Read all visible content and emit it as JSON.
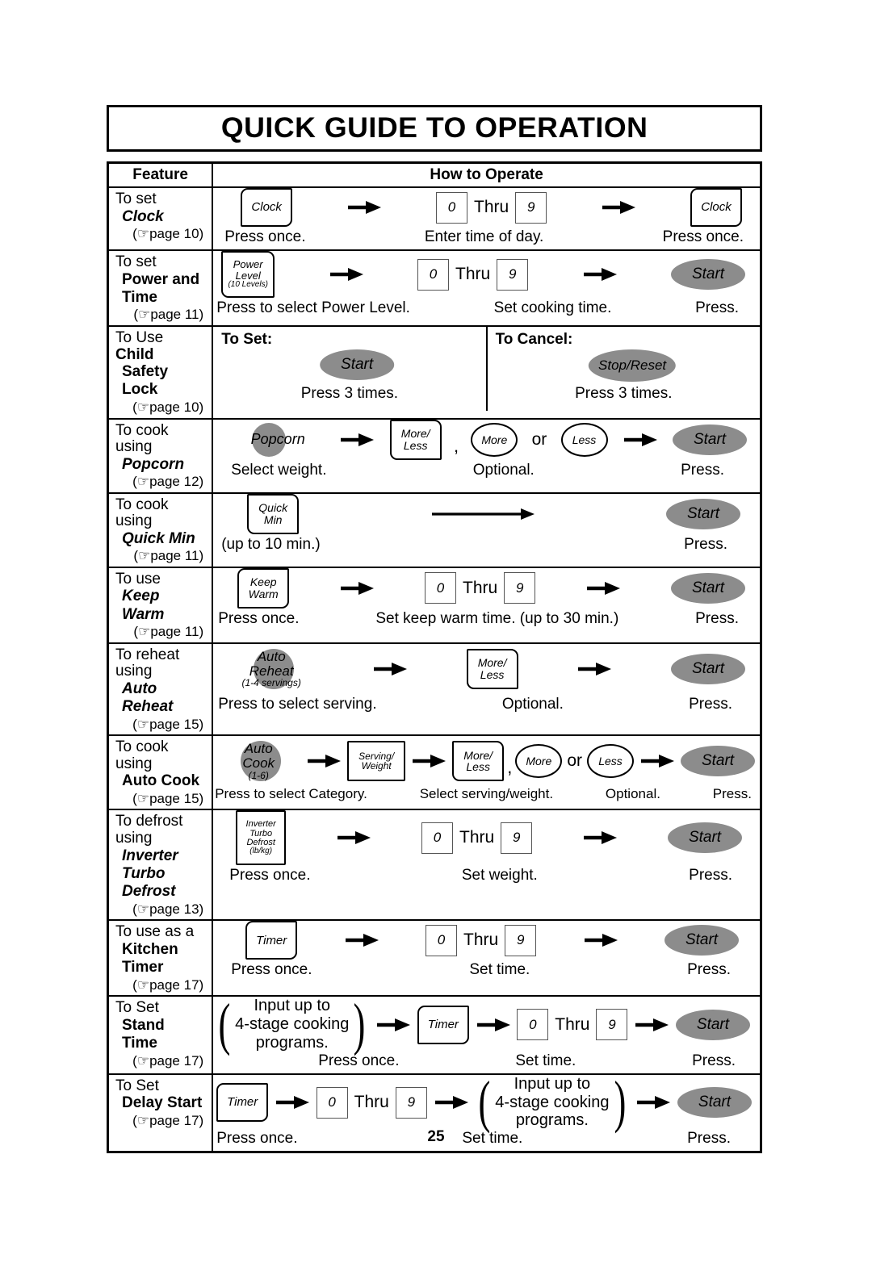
{
  "document": {
    "title": "QUICK GUIDE TO OPERATION",
    "page_number": "25"
  },
  "table": {
    "headers": {
      "feature": "Feature",
      "how_to_operate": "How to Operate"
    },
    "page_ref_icon": "pointing-hand-icon",
    "rows": [
      {
        "id": "clock",
        "feature": {
          "prefix": "To set",
          "name": "Clock",
          "style": "italic",
          "page_ref": "(☞page 10)",
          "page": "10"
        },
        "steps": [
          {
            "type": "button",
            "label": "Clock",
            "shape": "key-left"
          },
          {
            "type": "arrow"
          },
          {
            "type": "numrange",
            "from": "0",
            "thru": "Thru",
            "to": "9"
          },
          {
            "type": "arrow"
          },
          {
            "type": "button",
            "label": "Clock",
            "shape": "key-left"
          }
        ],
        "captions": [
          "Press once.",
          "Enter time of day.",
          "Press once."
        ]
      },
      {
        "id": "power-and-time",
        "feature": {
          "prefix": "To set",
          "name": "Power and Time",
          "style": "bold",
          "page_ref": "(☞page 11)",
          "page": "11"
        },
        "steps": [
          {
            "type": "button",
            "label": "Power\nLevel",
            "sublabel": "(10 Levels)",
            "shape": "key-right"
          },
          {
            "type": "arrow"
          },
          {
            "type": "numrange",
            "from": "0",
            "thru": "Thru",
            "to": "9"
          },
          {
            "type": "arrow"
          },
          {
            "type": "oval",
            "label": "Start"
          }
        ],
        "captions": [
          "Press to select Power Level.",
          "Set cooking time.",
          "Press."
        ]
      },
      {
        "id": "child-safety-lock",
        "feature": {
          "prefix": "To Use",
          "prefix_bold_tail": "Child",
          "name": "Safety Lock",
          "style": "bold",
          "page_ref": "(☞page 10)",
          "page": "10"
        },
        "split": {
          "left": {
            "header": "To Set:",
            "button": "Start",
            "caption": "Press 3 times."
          },
          "right": {
            "header": "To Cancel:",
            "button": "Stop/Reset",
            "caption": "Press 3 times."
          }
        }
      },
      {
        "id": "popcorn",
        "feature": {
          "prefix": "To cook using",
          "name": "Popcorn",
          "style": "italic",
          "page_ref": "(☞page 12)",
          "page": "12"
        },
        "steps": [
          {
            "type": "blob",
            "label": "Popcorn"
          },
          {
            "type": "arrow"
          },
          {
            "type": "button",
            "label": "More/\nLess",
            "shape": "key-right"
          },
          {
            "type": "comma",
            "label": ","
          },
          {
            "type": "circle",
            "label": "More"
          },
          {
            "type": "or",
            "label": "or"
          },
          {
            "type": "circle",
            "label": "Less"
          },
          {
            "type": "arrow"
          },
          {
            "type": "oval",
            "label": "Start"
          }
        ],
        "captions": [
          "Select weight.",
          "Optional.",
          "Press."
        ]
      },
      {
        "id": "quick-min",
        "feature": {
          "prefix": "To cook using",
          "name": "Quick Min",
          "style": "italic",
          "page_ref": "(☞page 11)",
          "page": "11"
        },
        "steps": [
          {
            "type": "button",
            "label": "Quick\nMin",
            "shape": "key-right"
          },
          {
            "type": "longarrow"
          },
          {
            "type": "oval",
            "label": "Start"
          }
        ],
        "captions": [
          "(up to 10 min.)",
          "Press."
        ]
      },
      {
        "id": "keep-warm",
        "feature": {
          "prefix": "To use",
          "name": "Keep Warm",
          "style": "italic",
          "page_ref": "(☞page 11)",
          "page": "11"
        },
        "steps": [
          {
            "type": "button",
            "label": "Keep\nWarm",
            "shape": "key-left"
          },
          {
            "type": "arrow"
          },
          {
            "type": "numrange",
            "from": "0",
            "thru": "Thru",
            "to": "9"
          },
          {
            "type": "arrow"
          },
          {
            "type": "oval",
            "label": "Start"
          }
        ],
        "captions": [
          "Press once.",
          "Set keep warm time. (up to 30 min.)",
          "Press."
        ]
      },
      {
        "id": "auto-reheat",
        "feature": {
          "prefix": "To reheat using",
          "name": "Auto Reheat",
          "style": "italic",
          "page_ref": "(☞page 15)",
          "page": "15"
        },
        "steps": [
          {
            "type": "blob",
            "label": "Auto\nReheat",
            "sublabel": "(1-4 servings)"
          },
          {
            "type": "arrow"
          },
          {
            "type": "button",
            "label": "More/\nLess",
            "shape": "key-right"
          },
          {
            "type": "arrow"
          },
          {
            "type": "oval",
            "label": "Start"
          }
        ],
        "captions": [
          "Press to select serving.",
          "Optional.",
          "Press."
        ]
      },
      {
        "id": "auto-cook",
        "feature": {
          "prefix": "To cook using",
          "name": "Auto Cook",
          "style": "bold",
          "page_ref": "(☞page 15)",
          "page": "15"
        },
        "steps": [
          {
            "type": "blob",
            "label": "Auto\nCook",
            "sublabel": "(1-6)"
          },
          {
            "type": "arrow"
          },
          {
            "type": "button",
            "label": "Serving/\nWeight",
            "shape": "plain"
          },
          {
            "type": "arrow"
          },
          {
            "type": "button",
            "label": "More/\nLess",
            "shape": "key-right"
          },
          {
            "type": "comma",
            "label": ","
          },
          {
            "type": "circle",
            "label": "More"
          },
          {
            "type": "or",
            "label": "or"
          },
          {
            "type": "circle",
            "label": "Less"
          },
          {
            "type": "arrow"
          },
          {
            "type": "oval",
            "label": "Start"
          }
        ],
        "captions": [
          "Press to select Category.",
          "Select serving/weight.",
          "Optional.",
          "Press."
        ]
      },
      {
        "id": "inverter-turbo-defrost",
        "feature": {
          "prefix": "To defrost using",
          "name": "Inverter Turbo",
          "name2": "Defrost",
          "style": "italic",
          "page_ref": "(☞page 13)",
          "page": "13"
        },
        "steps": [
          {
            "type": "button",
            "label": "Inverter\nTurbo\nDefrost",
            "sublabel": "(lb/kg)",
            "shape": "plain"
          },
          {
            "type": "arrow"
          },
          {
            "type": "numrange",
            "from": "0",
            "thru": "Thru",
            "to": "9"
          },
          {
            "type": "arrow"
          },
          {
            "type": "oval",
            "label": "Start"
          }
        ],
        "captions": [
          "Press once.",
          "Set weight.",
          "Press."
        ]
      },
      {
        "id": "kitchen-timer",
        "feature": {
          "prefix": "To use as a",
          "name": "Kitchen Timer",
          "style": "bold",
          "page_ref": "(☞page 17)",
          "page": "17"
        },
        "steps": [
          {
            "type": "button",
            "label": "Timer",
            "shape": "key-left"
          },
          {
            "type": "arrow"
          },
          {
            "type": "numrange",
            "from": "0",
            "thru": "Thru",
            "to": "9"
          },
          {
            "type": "arrow"
          },
          {
            "type": "oval",
            "label": "Start"
          }
        ],
        "captions": [
          "Press once.",
          "Set time.",
          "Press."
        ]
      },
      {
        "id": "stand-time",
        "feature": {
          "prefix": "To Set",
          "name": "Stand Time",
          "style": "bold",
          "page_ref": "(☞page 17)",
          "page": "17"
        },
        "steps": [
          {
            "type": "paren",
            "lines": [
              "Input up to",
              "4-stage cooking",
              "programs."
            ]
          },
          {
            "type": "arrow"
          },
          {
            "type": "button",
            "label": "Timer",
            "shape": "key-left"
          },
          {
            "type": "arrow"
          },
          {
            "type": "numrange",
            "from": "0",
            "thru": "Thru",
            "to": "9"
          },
          {
            "type": "arrow"
          },
          {
            "type": "oval",
            "label": "Start"
          }
        ],
        "captions": [
          "Press once.",
          "Set time.",
          "Press."
        ]
      },
      {
        "id": "delay-start",
        "feature": {
          "prefix": "To Set",
          "name": "Delay Start",
          "style": "bold",
          "page_ref": "(☞page 17)",
          "page": "17"
        },
        "steps": [
          {
            "type": "button",
            "label": "Timer",
            "shape": "key-left"
          },
          {
            "type": "arrow"
          },
          {
            "type": "numrange",
            "from": "0",
            "thru": "Thru",
            "to": "9"
          },
          {
            "type": "arrow"
          },
          {
            "type": "paren",
            "lines": [
              "Input up to",
              "4-stage cooking",
              "programs."
            ]
          },
          {
            "type": "arrow"
          },
          {
            "type": "oval",
            "label": "Start"
          }
        ],
        "captions": [
          "Press once.",
          "Set time.",
          "Press."
        ]
      }
    ]
  },
  "colors": {
    "button_fill": "#8c8c8c",
    "ink": "#000000",
    "paper": "#ffffff"
  }
}
